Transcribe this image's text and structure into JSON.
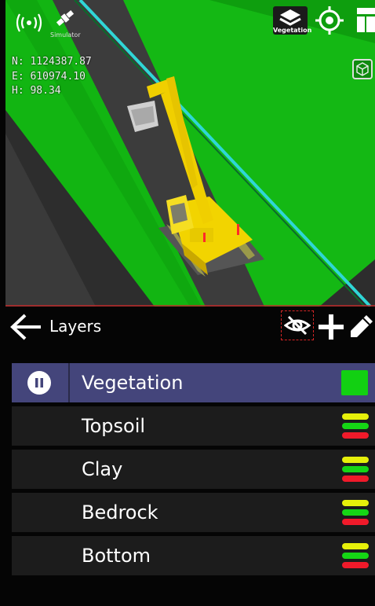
{
  "viewport": {
    "connection": "Simulator",
    "coordinates": {
      "north": "N: 1124387.87",
      "east": "E: 610974.10",
      "height": "H: 98.34"
    },
    "active_layer_badge": "Vegetation",
    "icons": [
      "signal-icon",
      "satellite-icon",
      "layers-icon",
      "target-icon",
      "menu-icon",
      "cube-view-icon"
    ]
  },
  "panel": {
    "title": "Layers",
    "layers": [
      {
        "name": "Vegetation",
        "active": true,
        "swatch": "#12d012"
      },
      {
        "name": "Topsoil",
        "active": false
      },
      {
        "name": "Clay",
        "active": false
      },
      {
        "name": "Bedrock",
        "active": false
      },
      {
        "name": "Bottom",
        "active": false
      }
    ],
    "colors": {
      "active_row": "#44457b",
      "row": "#1c1c1c",
      "stripe_yellow": "#e6f00a",
      "stripe_green": "#15d615",
      "stripe_red": "#f01a2a"
    }
  }
}
